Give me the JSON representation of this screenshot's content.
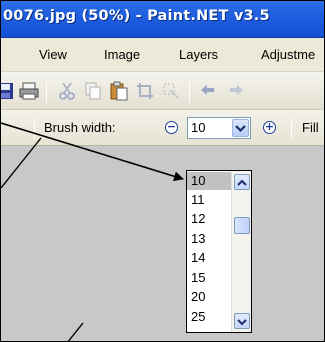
{
  "window": {
    "title": "0076.jpg (50%) - Paint.NET v3.5"
  },
  "menu": {
    "items": [
      "View",
      "Image",
      "Layers",
      "Adjustme"
    ]
  },
  "toolbar": {
    "icons": [
      "save-icon",
      "print-icon",
      "cut-icon",
      "copy-icon",
      "paste-icon",
      "crop-icon",
      "deselect-icon",
      "undo-icon",
      "redo-icon"
    ]
  },
  "brushbar": {
    "brush_label": "Brush width:",
    "width_value": "10",
    "fill_label": "Fill"
  },
  "dropdown": {
    "options": [
      "10",
      "11",
      "12",
      "13",
      "14",
      "15",
      "20",
      "25"
    ],
    "selected": "10"
  }
}
